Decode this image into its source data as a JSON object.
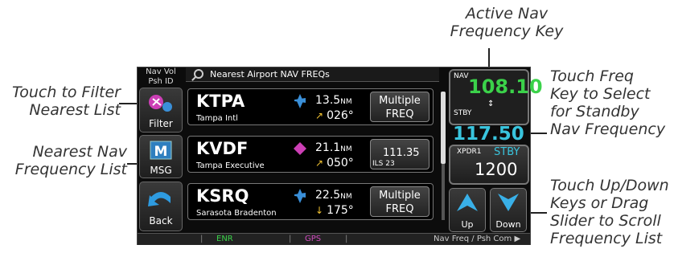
{
  "callouts": {
    "active_nav_line1": "Active Nav",
    "active_nav_line2": "Frequency Key",
    "filter_line1": "Touch to Filter",
    "filter_line2": "Nearest List",
    "nearest_line1": "Nearest Nav",
    "nearest_line2": "Frequency List",
    "freq_line1": "Touch Freq",
    "freq_line2": "Key to Select",
    "freq_line3": "for Standby",
    "freq_line4": "Nav Frequency",
    "updown_line1": "Touch Up/Down",
    "updown_line2": "Keys or Drag",
    "updown_line3": "Slider to Scroll",
    "updown_line4": "Frequency List"
  },
  "screen": {
    "nav_vol_line1": "Nav Vol",
    "nav_vol_line2": "Psh ID",
    "header_title": "Nearest Airport NAV FREQs",
    "filter_label": "Filter",
    "msg_label": "MSG",
    "back_label": "Back",
    "rows": [
      {
        "ident": "KTPA",
        "name": "Tampa Intl",
        "dist": "13.5",
        "dist_unit": "NM",
        "bearing": "026°",
        "freq_l1": "Multiple",
        "freq_l2": "FREQ",
        "symbol_color": "#3a8fd8"
      },
      {
        "ident": "KVDF",
        "name": "Tampa Executive",
        "dist": "21.1",
        "dist_unit": "NM",
        "bearing": "050°",
        "freq_l1": "111.35",
        "freq_l2": "ILS 23",
        "symbol_color": "#cc3fb5"
      },
      {
        "ident": "KSRQ",
        "name": "Sarasota Bradenton",
        "dist": "22.5",
        "dist_unit": "NM",
        "bearing": "175°",
        "freq_l1": "Multiple",
        "freq_l2": "FREQ",
        "symbol_color": "#3a8fd8"
      }
    ],
    "nav_label": "NAV",
    "nav_active": "108.10",
    "stby_label": "STBY",
    "nav_standby": "117.50",
    "xpdr_label": "XPDR1",
    "xpdr_mode": "STBY",
    "xpdr_code": "1200",
    "up_label": "Up",
    "down_label": "Down",
    "status_enr": "ENR",
    "status_gps": "GPS",
    "status_right": "Nav Freq / Psh Com ▶"
  },
  "colors": {
    "active_freq": "#3bd24a",
    "standby_freq": "#39c4dd",
    "enr": "#3bd24a",
    "gps": "#d24cc0"
  }
}
